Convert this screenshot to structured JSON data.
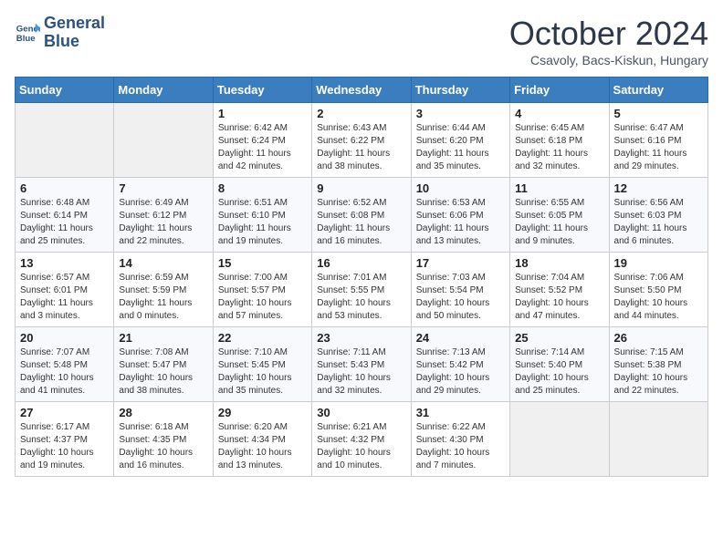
{
  "header": {
    "logo_line1": "General",
    "logo_line2": "Blue",
    "month": "October 2024",
    "location": "Csavoly, Bacs-Kiskun, Hungary"
  },
  "weekdays": [
    "Sunday",
    "Monday",
    "Tuesday",
    "Wednesday",
    "Thursday",
    "Friday",
    "Saturday"
  ],
  "weeks": [
    [
      {
        "day": "",
        "sunrise": "",
        "sunset": "",
        "daylight": ""
      },
      {
        "day": "",
        "sunrise": "",
        "sunset": "",
        "daylight": ""
      },
      {
        "day": "1",
        "sunrise": "Sunrise: 6:42 AM",
        "sunset": "Sunset: 6:24 PM",
        "daylight": "Daylight: 11 hours and 42 minutes."
      },
      {
        "day": "2",
        "sunrise": "Sunrise: 6:43 AM",
        "sunset": "Sunset: 6:22 PM",
        "daylight": "Daylight: 11 hours and 38 minutes."
      },
      {
        "day": "3",
        "sunrise": "Sunrise: 6:44 AM",
        "sunset": "Sunset: 6:20 PM",
        "daylight": "Daylight: 11 hours and 35 minutes."
      },
      {
        "day": "4",
        "sunrise": "Sunrise: 6:45 AM",
        "sunset": "Sunset: 6:18 PM",
        "daylight": "Daylight: 11 hours and 32 minutes."
      },
      {
        "day": "5",
        "sunrise": "Sunrise: 6:47 AM",
        "sunset": "Sunset: 6:16 PM",
        "daylight": "Daylight: 11 hours and 29 minutes."
      }
    ],
    [
      {
        "day": "6",
        "sunrise": "Sunrise: 6:48 AM",
        "sunset": "Sunset: 6:14 PM",
        "daylight": "Daylight: 11 hours and 25 minutes."
      },
      {
        "day": "7",
        "sunrise": "Sunrise: 6:49 AM",
        "sunset": "Sunset: 6:12 PM",
        "daylight": "Daylight: 11 hours and 22 minutes."
      },
      {
        "day": "8",
        "sunrise": "Sunrise: 6:51 AM",
        "sunset": "Sunset: 6:10 PM",
        "daylight": "Daylight: 11 hours and 19 minutes."
      },
      {
        "day": "9",
        "sunrise": "Sunrise: 6:52 AM",
        "sunset": "Sunset: 6:08 PM",
        "daylight": "Daylight: 11 hours and 16 minutes."
      },
      {
        "day": "10",
        "sunrise": "Sunrise: 6:53 AM",
        "sunset": "Sunset: 6:06 PM",
        "daylight": "Daylight: 11 hours and 13 minutes."
      },
      {
        "day": "11",
        "sunrise": "Sunrise: 6:55 AM",
        "sunset": "Sunset: 6:05 PM",
        "daylight": "Daylight: 11 hours and 9 minutes."
      },
      {
        "day": "12",
        "sunrise": "Sunrise: 6:56 AM",
        "sunset": "Sunset: 6:03 PM",
        "daylight": "Daylight: 11 hours and 6 minutes."
      }
    ],
    [
      {
        "day": "13",
        "sunrise": "Sunrise: 6:57 AM",
        "sunset": "Sunset: 6:01 PM",
        "daylight": "Daylight: 11 hours and 3 minutes."
      },
      {
        "day": "14",
        "sunrise": "Sunrise: 6:59 AM",
        "sunset": "Sunset: 5:59 PM",
        "daylight": "Daylight: 11 hours and 0 minutes."
      },
      {
        "day": "15",
        "sunrise": "Sunrise: 7:00 AM",
        "sunset": "Sunset: 5:57 PM",
        "daylight": "Daylight: 10 hours and 57 minutes."
      },
      {
        "day": "16",
        "sunrise": "Sunrise: 7:01 AM",
        "sunset": "Sunset: 5:55 PM",
        "daylight": "Daylight: 10 hours and 53 minutes."
      },
      {
        "day": "17",
        "sunrise": "Sunrise: 7:03 AM",
        "sunset": "Sunset: 5:54 PM",
        "daylight": "Daylight: 10 hours and 50 minutes."
      },
      {
        "day": "18",
        "sunrise": "Sunrise: 7:04 AM",
        "sunset": "Sunset: 5:52 PM",
        "daylight": "Daylight: 10 hours and 47 minutes."
      },
      {
        "day": "19",
        "sunrise": "Sunrise: 7:06 AM",
        "sunset": "Sunset: 5:50 PM",
        "daylight": "Daylight: 10 hours and 44 minutes."
      }
    ],
    [
      {
        "day": "20",
        "sunrise": "Sunrise: 7:07 AM",
        "sunset": "Sunset: 5:48 PM",
        "daylight": "Daylight: 10 hours and 41 minutes."
      },
      {
        "day": "21",
        "sunrise": "Sunrise: 7:08 AM",
        "sunset": "Sunset: 5:47 PM",
        "daylight": "Daylight: 10 hours and 38 minutes."
      },
      {
        "day": "22",
        "sunrise": "Sunrise: 7:10 AM",
        "sunset": "Sunset: 5:45 PM",
        "daylight": "Daylight: 10 hours and 35 minutes."
      },
      {
        "day": "23",
        "sunrise": "Sunrise: 7:11 AM",
        "sunset": "Sunset: 5:43 PM",
        "daylight": "Daylight: 10 hours and 32 minutes."
      },
      {
        "day": "24",
        "sunrise": "Sunrise: 7:13 AM",
        "sunset": "Sunset: 5:42 PM",
        "daylight": "Daylight: 10 hours and 29 minutes."
      },
      {
        "day": "25",
        "sunrise": "Sunrise: 7:14 AM",
        "sunset": "Sunset: 5:40 PM",
        "daylight": "Daylight: 10 hours and 25 minutes."
      },
      {
        "day": "26",
        "sunrise": "Sunrise: 7:15 AM",
        "sunset": "Sunset: 5:38 PM",
        "daylight": "Daylight: 10 hours and 22 minutes."
      }
    ],
    [
      {
        "day": "27",
        "sunrise": "Sunrise: 6:17 AM",
        "sunset": "Sunset: 4:37 PM",
        "daylight": "Daylight: 10 hours and 19 minutes."
      },
      {
        "day": "28",
        "sunrise": "Sunrise: 6:18 AM",
        "sunset": "Sunset: 4:35 PM",
        "daylight": "Daylight: 10 hours and 16 minutes."
      },
      {
        "day": "29",
        "sunrise": "Sunrise: 6:20 AM",
        "sunset": "Sunset: 4:34 PM",
        "daylight": "Daylight: 10 hours and 13 minutes."
      },
      {
        "day": "30",
        "sunrise": "Sunrise: 6:21 AM",
        "sunset": "Sunset: 4:32 PM",
        "daylight": "Daylight: 10 hours and 10 minutes."
      },
      {
        "day": "31",
        "sunrise": "Sunrise: 6:22 AM",
        "sunset": "Sunset: 4:30 PM",
        "daylight": "Daylight: 10 hours and 7 minutes."
      },
      {
        "day": "",
        "sunrise": "",
        "sunset": "",
        "daylight": ""
      },
      {
        "day": "",
        "sunrise": "",
        "sunset": "",
        "daylight": ""
      }
    ]
  ]
}
